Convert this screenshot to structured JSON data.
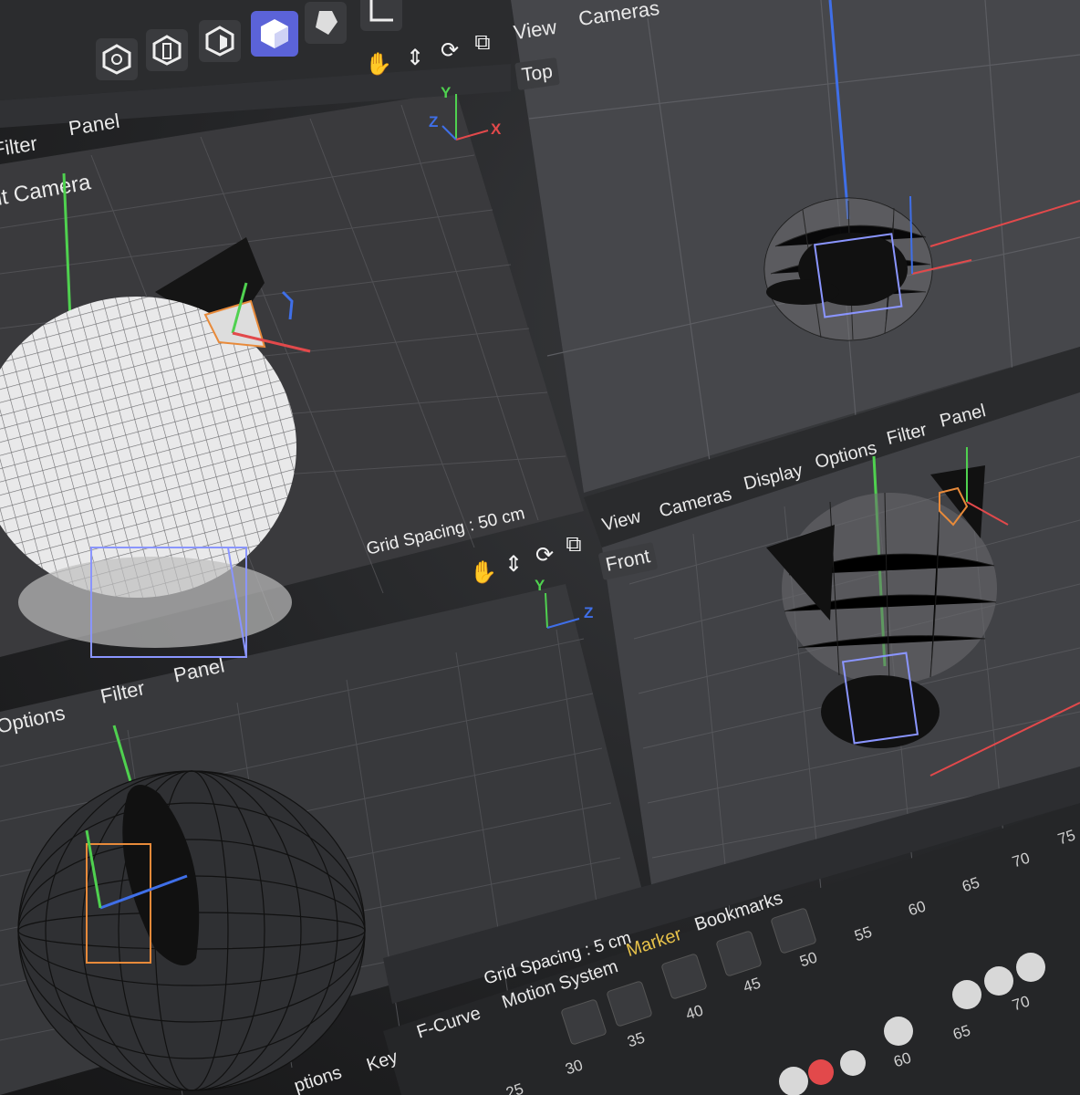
{
  "top_panel": {
    "menus": [
      "View",
      "Cameras"
    ],
    "viewport_label": "Top"
  },
  "perspective_panel": {
    "menus": [
      "Filter",
      "Panel"
    ],
    "viewport_label": "lt Camera",
    "grid_spacing": "Grid Spacing : 50 cm"
  },
  "front_panel": {
    "menus": [
      "View",
      "Cameras",
      "Display",
      "Options",
      "Filter",
      "Panel"
    ],
    "viewport_label": "Front"
  },
  "side_panel": {
    "menus": [
      "Options",
      "Filter",
      "Panel"
    ],
    "grid_spacing": "Grid Spacing : 5 cm"
  },
  "timeline": {
    "tabs": [
      "ptions",
      "Key",
      "F-Curve",
      "Motion System",
      "Marker",
      "Bookmarks"
    ],
    "active_tab": "Marker",
    "ticks_lower": [
      "25",
      "30",
      "35",
      "40",
      "45",
      "50",
      "55",
      "60",
      "65",
      "70",
      "75"
    ],
    "ticks_right": [
      "60",
      "65",
      "70"
    ]
  },
  "axes": {
    "x": "X",
    "y": "Y",
    "z": "Z"
  },
  "colors": {
    "accent": "#5b63d8",
    "axis_x": "#e2494b",
    "axis_y": "#4fd14f",
    "axis_z": "#3f6fe8",
    "marker": "#e7c24a"
  },
  "icons": [
    "hexagon-icon",
    "nurbs-icon",
    "cube-outline-icon",
    "cube-icon",
    "deformer-icon",
    "spline-icon",
    "hand-icon",
    "move-icon",
    "rotate-icon",
    "maximize-icon"
  ]
}
